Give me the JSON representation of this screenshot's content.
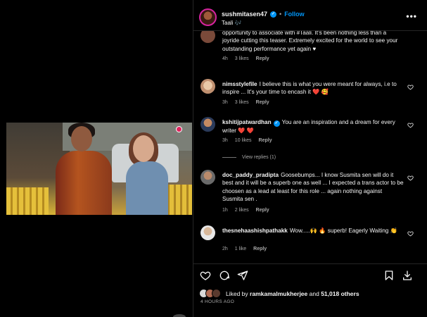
{
  "post": {
    "username": "sushmitasen47",
    "follow_label": "Follow",
    "dot": "•",
    "subtitle": "Taali 🎶",
    "more": "•••"
  },
  "comments": [
    {
      "user": "",
      "text": "opportunity to associate with #Taali. It's been nothing less than a joyride cutting this teaser. Extremely excited for the world to see your outstanding performance yet again ♥",
      "time": "4h",
      "likes": "3 likes",
      "reply": "Reply"
    },
    {
      "user": "nimsstylefile",
      "text": "I believe this is what you were meant for always, i.e to inspire ... It's your time to encash it ❤️ 🥰",
      "time": "3h",
      "likes": "3 likes",
      "reply": "Reply"
    },
    {
      "user": "kshitijpatwardhan",
      "text": "You are an inspiration and a dream for every writer ❤️ ❤️",
      "time": "3h",
      "likes": "10 likes",
      "reply": "Reply",
      "view_replies": "View replies (1)"
    },
    {
      "user": "doc_paddy_pradipta",
      "text": "Goosebumps... I know Susmita sen will do it best and it will be a superb one as well ... I expected a trans actor to be choosen as a lead at least for this role ... again nothing against Susmita sen .",
      "time": "1h",
      "likes": "2 likes",
      "reply": "Reply"
    },
    {
      "user": "thesnehaashishpathakk",
      "text": "Wow.....🙌 🔥 superb! Eagerly Waiting 👏",
      "time": "2h",
      "likes": "1 like",
      "reply": "Reply"
    }
  ],
  "likes": {
    "prefix": "Liked by",
    "user": "ramkamalmukherjee",
    "and": "and",
    "count": "51,018 others"
  },
  "timestamp": "4 HOURS AGO",
  "icons": {
    "like": "heart-icon",
    "comment": "comment-icon",
    "share": "send-icon",
    "save": "bookmark-icon",
    "download": "download-icon"
  }
}
